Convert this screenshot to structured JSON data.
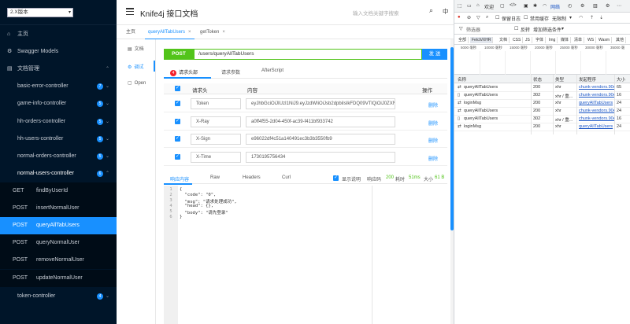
{
  "sidebar": {
    "version": "2.X版本",
    "items": [
      {
        "label": "主页",
        "icon": "home-icon"
      },
      {
        "label": "Swagger Models",
        "icon": "model-icon"
      },
      {
        "label": "文档管理",
        "icon": "folder-icon"
      },
      {
        "label": "basic-error-controller",
        "badge": "7"
      },
      {
        "label": "game-info-controller",
        "badge": "5"
      },
      {
        "label": "hh-orders-controller",
        "badge": "5"
      },
      {
        "label": "hh-users-controller",
        "badge": "5"
      },
      {
        "label": "normal-orders-controller",
        "badge": "5"
      },
      {
        "label": "normal-users-controller",
        "badge": "6"
      },
      {
        "label": "token-controller",
        "badge": "4"
      }
    ],
    "sub_items": [
      {
        "method": "GET",
        "path": "findByUserId"
      },
      {
        "method": "POST",
        "path": "insertNormalUser"
      },
      {
        "method": "POST",
        "path": "queryAllTabUsers"
      },
      {
        "method": "POST",
        "path": "queryNormalUser"
      },
      {
        "method": "POST",
        "path": "removeNormalUser"
      },
      {
        "method": "POST",
        "path": "updateNormalUser"
      }
    ]
  },
  "header": {
    "title": "Knife4j 接口文档",
    "search_placeholder": "输入文档关键字搜索",
    "lang": "中"
  },
  "tabs": [
    {
      "label": "主页"
    },
    {
      "label": "queryAllTabUsers"
    },
    {
      "label": "getToken"
    }
  ],
  "left_nav": [
    {
      "label": "文档"
    },
    {
      "label": "调试"
    },
    {
      "label": "Open"
    }
  ],
  "request": {
    "method": "POST",
    "url": "/users/queryAllTabUsers",
    "send_label": "发 送"
  },
  "sub_tabs": {
    "header_count": "4",
    "headers": "请求头部",
    "params": "请求参数",
    "script": "AfterScript"
  },
  "headers_table": {
    "col_name": "请求头",
    "col_value": "内容",
    "col_action": "操作",
    "rows": [
      {
        "name": "Token",
        "value": "eyJhbGciOiJIUzI1NiJ9.eyJzdWIiOiJsb2dpbiIsIkFDQ09VTlQiOiJ0ZXN0",
        "action": "删除"
      },
      {
        "name": "X-Ray",
        "value": "a0ff4f55-2d04-450f-ac39-f411bf933742",
        "action": "删除"
      },
      {
        "name": "X-Sign",
        "value": "e96022df4c51a140491ec3b3b3550fb9",
        "action": "删除"
      },
      {
        "name": "X-Time",
        "value": "1730195756434",
        "action": "删除"
      }
    ]
  },
  "response_tabs": {
    "content": "响应内容",
    "raw": "Raw",
    "headers": "Headers",
    "curl": "Curl",
    "show_desc": "显示说明",
    "code_label": "响应码",
    "code": "200",
    "time_label": "耗时",
    "time": "51ms",
    "size_label": "大小",
    "size": "61 B"
  },
  "code_lines": [
    {
      "n": "1",
      "text": "{"
    },
    {
      "n": "2",
      "text": "  \"code\": \"0\","
    },
    {
      "n": "3",
      "text": "  \"msg\": \"请求处理成功\","
    },
    {
      "n": "4",
      "text": "  \"head\": {},"
    },
    {
      "n": "5",
      "text": "  \"body\": \"请先登录\""
    },
    {
      "n": "6",
      "text": "}"
    }
  ],
  "devtools": {
    "tabs": [
      "欢迎",
      "网络"
    ],
    "toolbar": {
      "preserve_log": "保留日志",
      "disable_cache": "禁用缓存",
      "throttle": "无限制"
    },
    "filter_placeholder": "筛选器",
    "invert": "反转",
    "more_filters": "增加筛选条件",
    "types": [
      "全部",
      "Fetch/XHR",
      "文档",
      "CSS",
      "JS",
      "字体",
      "Img",
      "媒体",
      "清单",
      "WS",
      "Wasm",
      "其他"
    ],
    "timeline": [
      "5000 毫秒",
      "10000 毫秒",
      "15000 毫秒",
      "20000 毫秒",
      "25000 毫秒",
      "30000 毫秒",
      "35000 毫"
    ],
    "columns": {
      "name": "名称",
      "status": "状态",
      "type": "类型",
      "initiator": "发起程序",
      "size": "大小"
    },
    "rows": [
      {
        "name": "queryAllTabUsers",
        "status": "200",
        "type": "xhr",
        "initiator": "chunk-vendors.90e",
        "size": "65"
      },
      {
        "name": "queryAllTabUsers",
        "status": "302",
        "type": "xhr / 重...",
        "initiator": "chunk-vendors.90e",
        "size": "16"
      },
      {
        "name": "loginMsg",
        "status": "200",
        "type": "xhr",
        "initiator": "queryAllTabUsers",
        "size": "24"
      },
      {
        "name": "queryAllTabUsers",
        "status": "200",
        "type": "xhr",
        "initiator": "chunk-vendors.90e",
        "size": "24"
      },
      {
        "name": "queryAllTabUsers",
        "status": "302",
        "type": "xhr / 重...",
        "initiator": "chunk-vendors.90e",
        "size": "16"
      },
      {
        "name": "loginMsg",
        "status": "200",
        "type": "xhr",
        "initiator": "queryAllTabUsers",
        "size": "24"
      }
    ]
  },
  "colors": {
    "accent": "#1890ff",
    "post": "#52c41a",
    "sidebar": "#001529"
  }
}
